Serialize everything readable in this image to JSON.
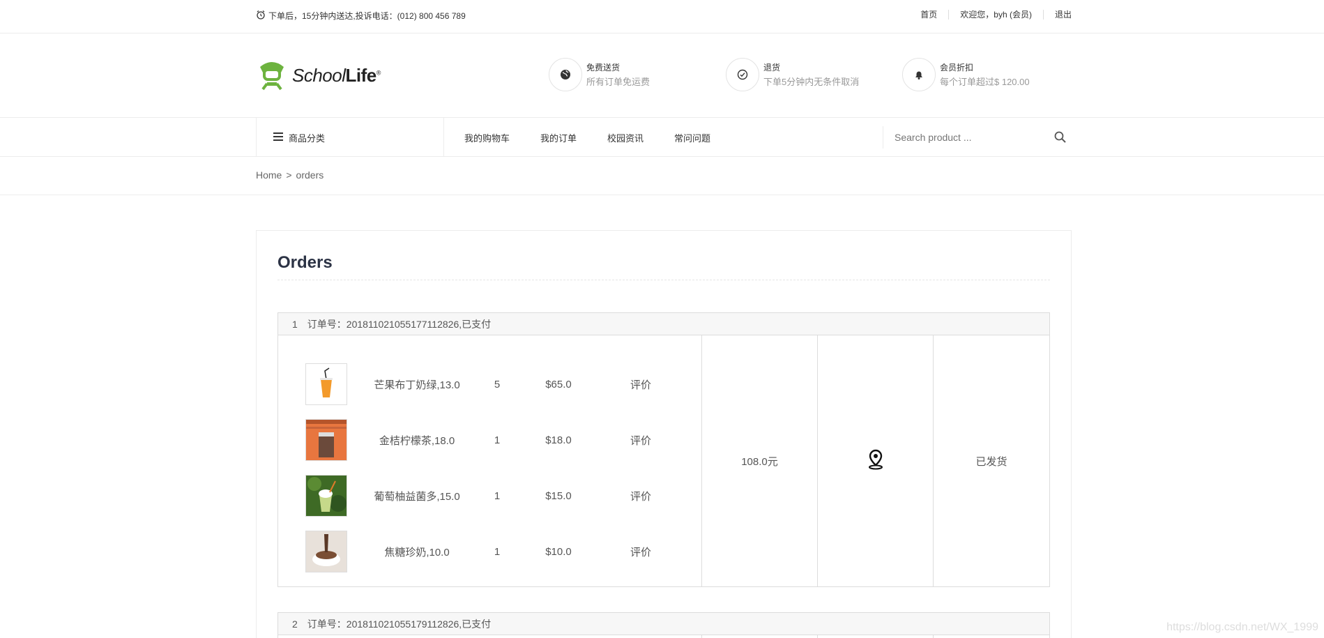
{
  "topbar": {
    "notice": "下单后，15分钟内送达,投诉电话：(012) 800 456 789",
    "links": [
      "首页",
      "欢迎您，byh (会员)",
      "退出"
    ]
  },
  "header": {
    "logo_text_a": "School",
    "logo_text_b": "Life",
    "logo_reg": "®",
    "features": [
      {
        "icon": "globe-icon",
        "title": "免费送货",
        "desc": "所有订单免运费"
      },
      {
        "icon": "check-circle-icon",
        "title": "退货",
        "desc": "下单5分钟内无条件取消"
      },
      {
        "icon": "bell-icon",
        "title": "会员折扣",
        "desc": "每个订单超过$ 120.00"
      }
    ]
  },
  "nav": {
    "category_label": "商品分类",
    "menu": [
      "我的购物车",
      "我的订单",
      "校园资讯",
      "常问问题"
    ],
    "search_placeholder": "Search product ..."
  },
  "breadcrumb": {
    "home": "Home",
    "sep": ">",
    "current": "orders"
  },
  "orders_title": "Orders",
  "orders": [
    {
      "index": "1",
      "header": "订单号：20181102105517711282​6,已支付",
      "items": [
        {
          "name": "芒果布丁奶绿,13.0",
          "qty": "5",
          "price": "$65.0",
          "action": "评价",
          "color": "#f39a2b"
        },
        {
          "name": "金桔柠檬茶,18.0",
          "qty": "1",
          "price": "$18.0",
          "action": "评价",
          "color": "#e8763f"
        },
        {
          "name": "葡萄柚益菌多,15.0",
          "qty": "1",
          "price": "$15.0",
          "action": "评价",
          "color": "#4b7a2b"
        },
        {
          "name": "焦糖珍奶,10.0",
          "qty": "1",
          "price": "$10.0",
          "action": "评价",
          "color": "#8a6a55"
        }
      ],
      "total": "108.0元",
      "status": "已发货"
    },
    {
      "index": "2",
      "header": "订单号：201811021055179112826,已支付"
    }
  ],
  "watermark": "https://blog.csdn.net/WX_1999"
}
